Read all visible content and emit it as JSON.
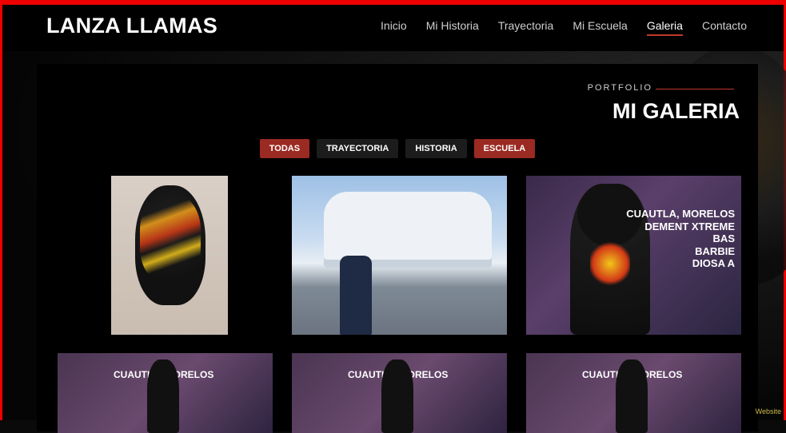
{
  "header": {
    "logo": "LANZA LLAMAS",
    "nav": [
      "Inicio",
      "Mi Historia",
      "Trayectoria",
      "Mi Escuela",
      "Galeria",
      "Contacto"
    ],
    "active_nav": "Galeria",
    "accent": "#c0392b"
  },
  "gallery": {
    "eyebrow": "PORTFOLIO",
    "title": "MI GALERIA",
    "filters": [
      "TODAS",
      "TRAYECTORIA",
      "HISTORIA",
      "ESCUELA"
    ],
    "active_filters": [
      "TODAS",
      "ESCUELA"
    ],
    "poster_text": [
      "CUAUTLA, MORELOS",
      "DEMENT XTREME",
      "BAS",
      "BARBIE",
      "DIOSA A"
    ],
    "row2_caption": "CUAUTLA, MORELOS"
  },
  "watermark": "Website"
}
